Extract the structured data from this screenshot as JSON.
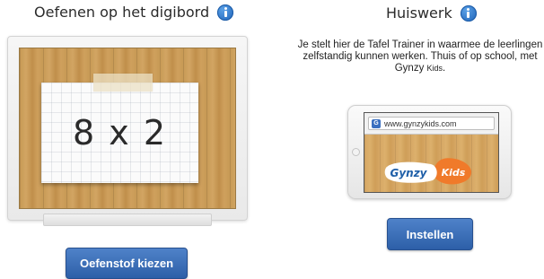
{
  "practice": {
    "title": "Oefenen op het digibord",
    "info_icon": "info-icon",
    "board_card_text": "8 x 2",
    "button_label": "Oefenstof kiezen"
  },
  "homework": {
    "title": "Huiswerk",
    "info_icon": "info-icon",
    "description_main": "Je stelt hier de Tafel Trainer in waarmee de leerlingen zelfstandig kunnen werken. Thuis of op school, met Gynzy",
    "description_small": "Kids",
    "description_end": ".",
    "tablet": {
      "browser_icon": "G",
      "url": "www.gynzykids.com",
      "logo_text_main": "Gynzy",
      "logo_text_kids": "Kids"
    },
    "button_label": "Instellen"
  },
  "colors": {
    "button": "#3a6bb5",
    "info_icon": "#2a6fc4",
    "wood": "#c99a55",
    "logo_orange": "#f07a2a",
    "logo_blue": "#1f5fa8"
  }
}
